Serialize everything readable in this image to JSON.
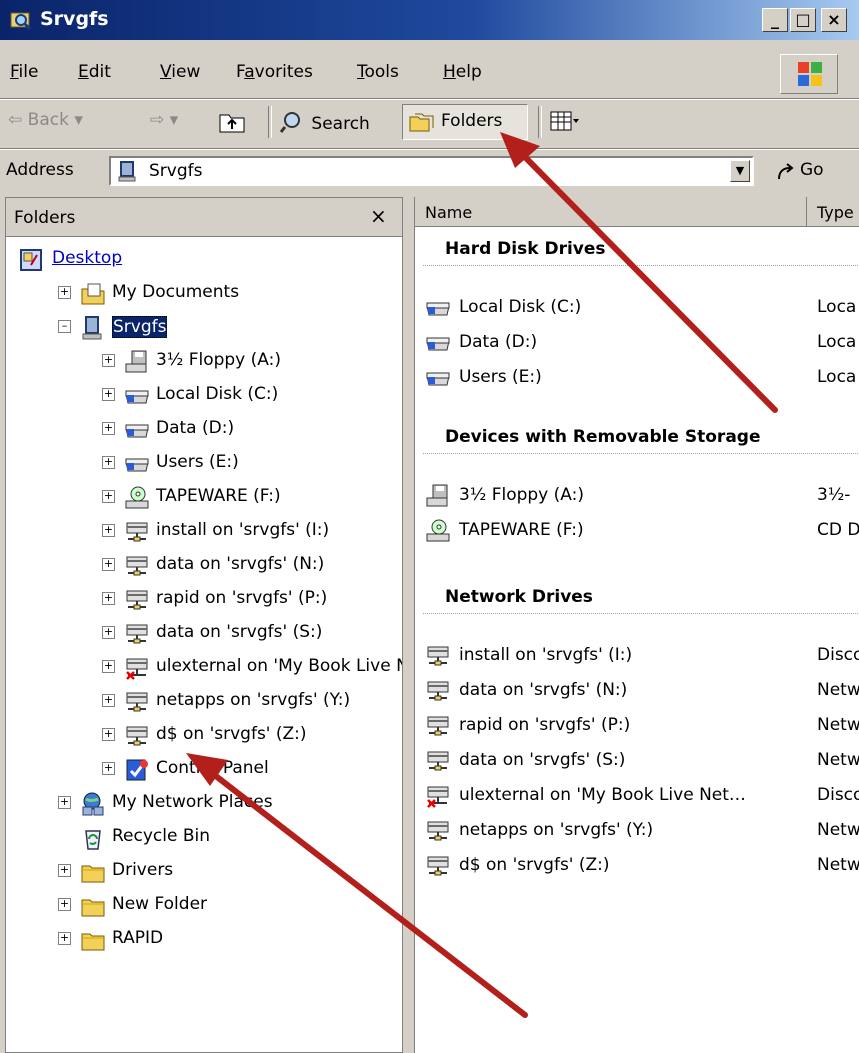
{
  "window": {
    "title": "Srvgfs"
  },
  "menu": [
    {
      "label": "File",
      "key": "F",
      "rest": "ile"
    },
    {
      "label": "Edit",
      "key": "E",
      "rest": "dit"
    },
    {
      "label": "View",
      "key": "V",
      "rest": "iew"
    },
    {
      "label": "Favorites",
      "pre": "F",
      "key": "a",
      "rest": "vorites"
    },
    {
      "label": "Tools",
      "key": "T",
      "rest": "ools"
    },
    {
      "label": "Help",
      "key": "H",
      "rest": "elp"
    }
  ],
  "toolbar": {
    "back": "Back",
    "search": "Search",
    "folders": "Folders"
  },
  "address": {
    "label": "Address",
    "value": "Srvgfs",
    "go": "Go"
  },
  "folders_pane": {
    "title": "Folders",
    "close": "×",
    "nodes": [
      {
        "label": "Desktop",
        "icon": "desktop-icon",
        "expander": "",
        "link": true
      },
      {
        "label": "My Documents",
        "icon": "my-documents-icon",
        "expander": "+"
      },
      {
        "label": "Srvgfs",
        "icon": "computer-icon",
        "expander": "−",
        "selected": true
      },
      {
        "label": "3½ Floppy (A:)",
        "icon": "floppy-drive-icon",
        "expander": "+"
      },
      {
        "label": "Local Disk (C:)",
        "icon": "hard-disk-icon",
        "expander": "+"
      },
      {
        "label": "Data (D:)",
        "icon": "hard-disk-icon",
        "expander": "+"
      },
      {
        "label": "Users (E:)",
        "icon": "hard-disk-icon",
        "expander": "+"
      },
      {
        "label": "TAPEWARE (F:)",
        "icon": "cd-drive-icon",
        "expander": "+"
      },
      {
        "label": "install on 'srvgfs' (I:)",
        "icon": "network-drive-icon",
        "expander": "+"
      },
      {
        "label": "data on 'srvgfs' (N:)",
        "icon": "network-drive-icon",
        "expander": "+"
      },
      {
        "label": "rapid on 'srvgfs' (P:)",
        "icon": "network-drive-icon",
        "expander": "+"
      },
      {
        "label": "data on 'srvgfs' (S:)",
        "icon": "network-drive-icon",
        "expander": "+"
      },
      {
        "label": "ulexternal on 'My Book Live N",
        "icon": "disconnected-drive-icon",
        "expander": "+"
      },
      {
        "label": "netapps on 'srvgfs' (Y:)",
        "icon": "network-drive-icon",
        "expander": "+"
      },
      {
        "label": "d$ on 'srvgfs' (Z:)",
        "icon": "network-drive-icon",
        "expander": "+"
      },
      {
        "label": "Control Panel",
        "icon": "control-panel-icon",
        "expander": "+"
      },
      {
        "label": "My Network Places",
        "icon": "network-places-icon",
        "expander": "+"
      },
      {
        "label": "Recycle Bin",
        "icon": "recycle-bin-icon",
        "expander": ""
      },
      {
        "label": "Drivers",
        "icon": "folder-icon",
        "expander": "+"
      },
      {
        "label": "New Folder",
        "icon": "folder-icon",
        "expander": "+"
      },
      {
        "label": "RAPID",
        "icon": "folder-icon",
        "expander": "+"
      }
    ]
  },
  "list": {
    "columns": {
      "name": "Name",
      "type": "Type"
    },
    "groups": [
      {
        "title": "Hard Disk Drives",
        "items": [
          {
            "name": "Local Disk (C:)",
            "type": "Loca",
            "icon": "hard-disk-icon"
          },
          {
            "name": "Data (D:)",
            "type": "Loca",
            "icon": "hard-disk-icon"
          },
          {
            "name": "Users (E:)",
            "type": "Loca",
            "icon": "hard-disk-icon"
          }
        ]
      },
      {
        "title": "Devices with Removable Storage",
        "items": [
          {
            "name": "3½ Floppy (A:)",
            "type": "3½-",
            "icon": "floppy-drive-icon"
          },
          {
            "name": "TAPEWARE (F:)",
            "type": "CD D",
            "icon": "cd-drive-icon"
          }
        ]
      },
      {
        "title": "Network Drives",
        "items": [
          {
            "name": "install on 'srvgfs' (I:)",
            "type": "Disco",
            "icon": "network-drive-icon"
          },
          {
            "name": "data on 'srvgfs' (N:)",
            "type": "Netw",
            "icon": "network-drive-icon"
          },
          {
            "name": "rapid on 'srvgfs' (P:)",
            "type": "Netw",
            "icon": "network-drive-icon"
          },
          {
            "name": "data on 'srvgfs' (S:)",
            "type": "Netw",
            "icon": "network-drive-icon"
          },
          {
            "name": "ulexternal on 'My Book Live Net…",
            "type": "Disco",
            "icon": "disconnected-drive-icon"
          },
          {
            "name": "netapps on 'srvgfs' (Y:)",
            "type": "Netw",
            "icon": "network-drive-icon"
          },
          {
            "name": "d$ on 'srvgfs' (Z:)",
            "type": "Netw",
            "icon": "network-drive-icon"
          }
        ]
      }
    ]
  },
  "colors": {
    "annotation_arrow": "#b3201c",
    "title_bar": "#0a246a",
    "link": "#0000c8"
  }
}
